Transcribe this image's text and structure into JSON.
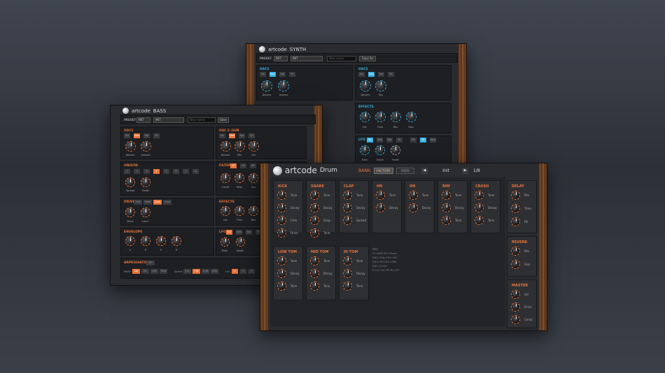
{
  "synth": {
    "brand": "artcode",
    "product": "SYNTH",
    "preset_label": "PRESET",
    "bank_val": "INIT",
    "preset_val": "INIT",
    "name_placeholder": "New name",
    "save_as": "Save As",
    "osc1": "OSC1",
    "osc2": "OSC2",
    "effects": "EFFECTS",
    "lfo": "LFO",
    "waves": [
      "Sin",
      "Saw",
      "Sqr",
      "Tri"
    ],
    "detune": "Detune",
    "volume": "Volume",
    "mix": "Mix",
    "dly": "Dly",
    "time": "Time",
    "rev": "Rev",
    "size": "Size",
    "rate": "Rate",
    "depth": "Depth",
    "pwidth": "Pwdth",
    "lfo_targets": [
      "Flt",
      "Amp"
    ]
  },
  "bass": {
    "brand": "artcode",
    "product": "BASS",
    "preset_label": "PRESET",
    "bank_val": "INIT",
    "preset_val": "INIT",
    "name_placeholder": "New name",
    "save": "Save",
    "osc1": "OSC1",
    "osc2": "OSC 2 /SUB",
    "unison": "UNISON",
    "filter": "FILTER",
    "drive": "DRIVE",
    "effects": "EFFECTS",
    "envelope": "ENVELOPE",
    "lfo": "LFO",
    "arp": "ARPEGGIATOR",
    "waves": [
      "Sin",
      "Saw",
      "Sqr",
      "Tri"
    ],
    "unison_vals": [
      "1",
      "2",
      "3",
      "4",
      "5",
      "6",
      "7",
      "8"
    ],
    "filter_types": [
      "LP",
      "HP",
      "BP"
    ],
    "drive_types": [
      "Soft",
      "Hard",
      "Tube",
      "Fuzz"
    ],
    "detune": "Detune",
    "volume": "Volume",
    "mix": "Mix",
    "oct": "Oct",
    "spread": "Spread",
    "pwdth": "Pwdth",
    "cutoff": "Cutoff",
    "reso": "Reso",
    "env": "Env",
    "drive_k": "Drive",
    "lowcut": "Low+",
    "dly": "Dly",
    "time": "Time",
    "rev": "Rev",
    "a": "A",
    "d": "D",
    "s": "S",
    "r": "R",
    "rate": "Rate",
    "depth": "Depth",
    "arp_off": "OFF",
    "mode_label": "Mode",
    "modes": [
      "Up",
      "Dn",
      "U/D",
      "Rnd"
    ],
    "speed_label": "Speed",
    "speeds": [
      "1/4",
      "1/8",
      "1/16",
      "1/32"
    ],
    "oct_label": "Oct",
    "octs": [
      "1",
      "2",
      "3"
    ]
  },
  "drum": {
    "brand": "artcode",
    "product": "Drum",
    "bank_label": "BANK:",
    "factory": "FACTORY",
    "user": "USER",
    "preset": "Init",
    "page": "1/8",
    "sections": [
      {
        "name": "KICK",
        "params": [
          "Tune",
          "Decay",
          "Click",
          "Drive"
        ]
      },
      {
        "name": "SNARE",
        "params": [
          "Tune",
          "Decay",
          "Snap",
          "Tone"
        ]
      },
      {
        "name": "CLAP",
        "params": [
          "Tune",
          "Decay",
          "Spread"
        ]
      },
      {
        "name": "HH",
        "params": [
          "Tune",
          "Decay"
        ]
      },
      {
        "name": "OH",
        "params": [
          "Tune",
          "Decay"
        ]
      },
      {
        "name": "RIM",
        "params": [
          "Tune",
          "Decay",
          "Tone"
        ]
      },
      {
        "name": "CRASH",
        "params": [
          "Tune",
          "Decay",
          "Tone"
        ]
      },
      {
        "name": "LOW TOM",
        "params": [
          "Tune",
          "Decay",
          "Tone"
        ]
      },
      {
        "name": "MID TOM",
        "params": [
          "Tune",
          "Decay",
          "Tone"
        ]
      },
      {
        "name": "HI TOM",
        "params": [
          "Tune",
          "Decay",
          "Tone"
        ]
      }
    ],
    "delay": {
      "name": "DELAY",
      "params": [
        "Mix",
        "Time",
        "FB"
      ]
    },
    "reverb": {
      "name": "REVERB",
      "params": [
        "Mix",
        "Size"
      ]
    },
    "master": {
      "name": "MASTER",
      "params": [
        "Vol",
        "Drive",
        "Comp"
      ]
    },
    "midi_lines": [
      "MIDI",
      "C1=KICK D1=Snare",
      "D#1=Clap F#1=HH",
      "A#1=OH C#1=RIM",
      "D#1=Crash",
      "F1=LT G1=MT B1=HT"
    ],
    "colors": {
      "accent_orange": "#e8733a",
      "accent_blue": "#39b4e6"
    }
  }
}
